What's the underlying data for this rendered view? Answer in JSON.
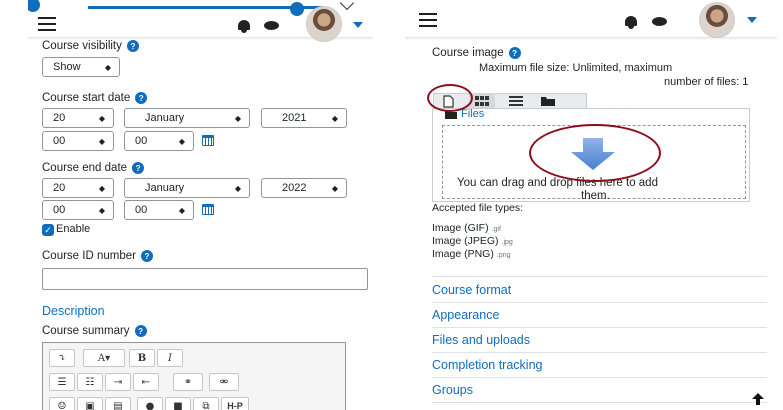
{
  "left": {
    "course_visibility": {
      "label": "Course visibility",
      "value": "Show"
    },
    "start_date": {
      "label": "Course start date",
      "day": "20",
      "month": "January",
      "year": "2021",
      "hour": "00",
      "minute": "00"
    },
    "end_date": {
      "label": "Course end date",
      "day": "20",
      "month": "January",
      "year": "2022",
      "hour": "00",
      "minute": "00",
      "enable_label": "Enable",
      "enable_checked": true
    },
    "course_id": {
      "label": "Course ID number",
      "value": ""
    },
    "description_heading": "Description",
    "course_summary_label": "Course summary",
    "editor_toolbar_row1": [
      "⤵",
      "A▾",
      "B",
      "I"
    ],
    "editor_toolbar_row3_last": "H-P"
  },
  "right": {
    "course_image": {
      "label": "Course image",
      "max_info_line1": "Maximum file size: Unlimited, maximum",
      "max_info_line2": "number of files: 1",
      "files_link": "Files",
      "drop_text_line1": "You can drag and drop files here to add",
      "drop_text_line2": "them.",
      "accepted_label": "Accepted file types:",
      "file_types": [
        {
          "name": "Image (GIF)",
          "ext": ".gif"
        },
        {
          "name": "Image (JPEG)",
          "ext": ".jpg"
        },
        {
          "name": "Image (PNG)",
          "ext": ".png"
        }
      ]
    },
    "sections": [
      "Course format",
      "Appearance",
      "Files and uploads",
      "Completion tracking",
      "Groups"
    ]
  },
  "colors": {
    "accent": "#0f6cbf",
    "annotation": "#8b0f1a"
  },
  "icons": {
    "menu": "hamburger-icon",
    "notifications": "bell-icon",
    "messages": "chat-icon",
    "help": "question-circle-icon",
    "calendar": "calendar-icon",
    "upload": "arrow-down-icon",
    "back_to_top": "arrow-up-icon"
  }
}
